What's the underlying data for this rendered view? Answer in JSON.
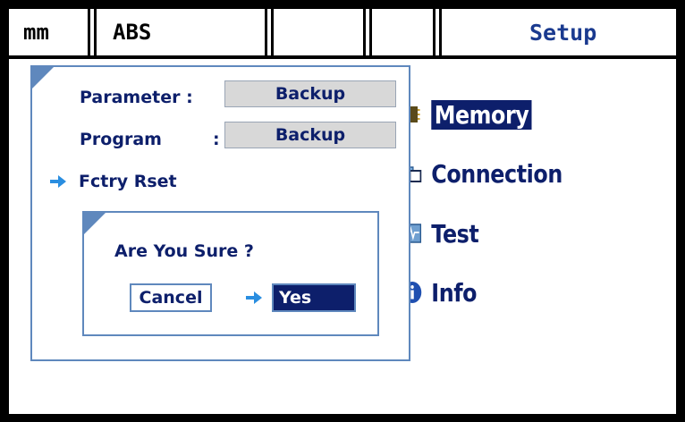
{
  "tabs": {
    "unit": "mm",
    "mode": "ABS",
    "blank1": "",
    "blank2": "",
    "title": "Setup"
  },
  "menu": {
    "items": [
      {
        "label": "Memory",
        "icon": "memory-chip-icon",
        "selected": true
      },
      {
        "label": "Connection",
        "icon": "connection-icon",
        "selected": false
      },
      {
        "label": "Test",
        "icon": "test-chart-icon",
        "selected": false
      },
      {
        "label": "Info",
        "icon": "info-icon",
        "selected": false
      }
    ]
  },
  "panel": {
    "parameter_label": "Parameter :",
    "parameter_value": "Backup",
    "program_label": "Program",
    "program_colon": ":",
    "program_value": "Backup",
    "factory_reset_label": "Fctry Rset"
  },
  "dialog": {
    "question": "Are You Sure ?",
    "cancel_label": "Cancel",
    "yes_label": "Yes"
  },
  "colors": {
    "accent": "#0d1f6b",
    "panel_border": "#5f88bd",
    "arrow": "#2a8ee0",
    "value_box": "#d8d8d8"
  }
}
